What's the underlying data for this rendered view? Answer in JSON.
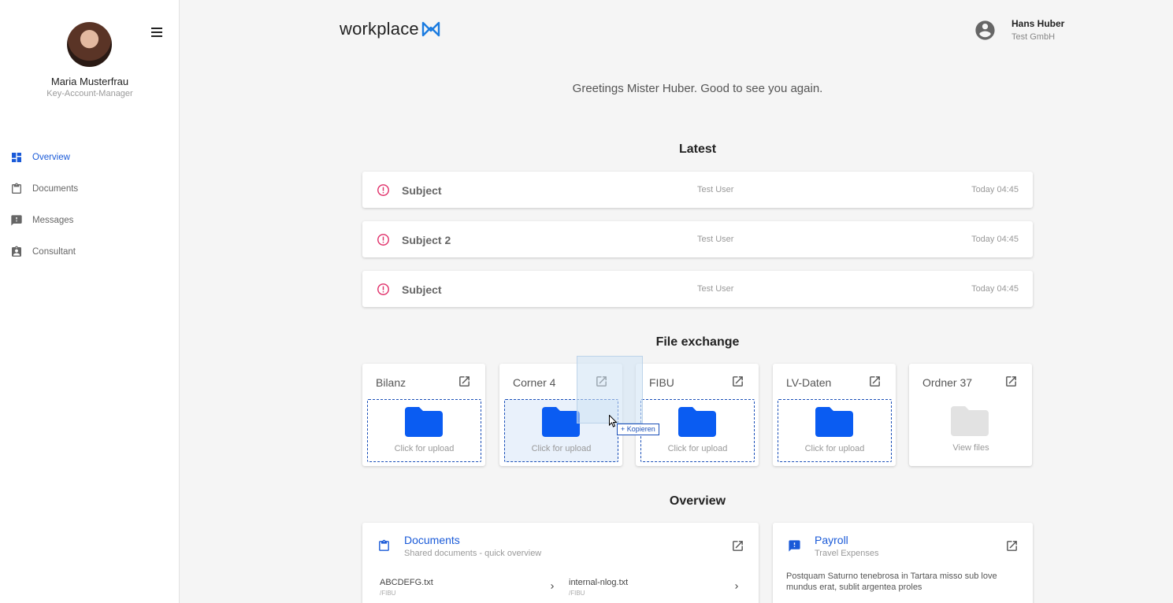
{
  "sidebar": {
    "user_name": "Maria Musterfrau",
    "user_role": "Key-Account-Manager",
    "items": [
      {
        "label": "Overview",
        "icon": "dashboard-icon",
        "active": true
      },
      {
        "label": "Documents",
        "icon": "clipboard-icon",
        "active": false
      },
      {
        "label": "Messages",
        "icon": "message-alert-icon",
        "active": false
      },
      {
        "label": "Consultant",
        "icon": "contact-badge-icon",
        "active": false
      }
    ]
  },
  "header": {
    "logo_text": "workplace",
    "user_name": "Hans Huber",
    "user_company": "Test GmbH"
  },
  "greeting": "Greetings Mister Huber. Good to see you again.",
  "latest": {
    "title": "Latest",
    "items": [
      {
        "subject": "Subject",
        "user": "Test User",
        "time": "Today 04:45"
      },
      {
        "subject": "Subject 2",
        "user": "Test User",
        "time": "Today 04:45"
      },
      {
        "subject": "Subject",
        "user": "Test User",
        "time": "Today 04:45"
      }
    ]
  },
  "file_exchange": {
    "title": "File exchange",
    "folders": [
      {
        "name": "Bilanz",
        "action": "Click for upload"
      },
      {
        "name": "Corner 4",
        "action": "Click for upload"
      },
      {
        "name": "FIBU",
        "action": "Click for upload"
      },
      {
        "name": "LV-Daten",
        "action": "Click for upload"
      },
      {
        "name": "Ordner 37",
        "action": "View files"
      }
    ],
    "drag_tooltip": "Kopieren"
  },
  "overview": {
    "title": "Overview",
    "documents": {
      "title": "Documents",
      "subtitle": "Shared documents - quick overview",
      "files": [
        {
          "name": "ABCDEFG.txt",
          "path": "/FIBU"
        },
        {
          "name": "internal-nlog.txt",
          "path": "/FIBU"
        }
      ]
    },
    "payroll": {
      "title": "Payroll",
      "subtitle": "Travel Expenses",
      "text": "Postquam Saturno tenebrosa in Tartara misso sub love mundus erat, sublit argentea proles"
    }
  },
  "colors": {
    "accent": "#1a5ad8",
    "folder": "#0a5cf2",
    "folder_disabled": "#e2e2e2",
    "alert": "#e0306a"
  }
}
